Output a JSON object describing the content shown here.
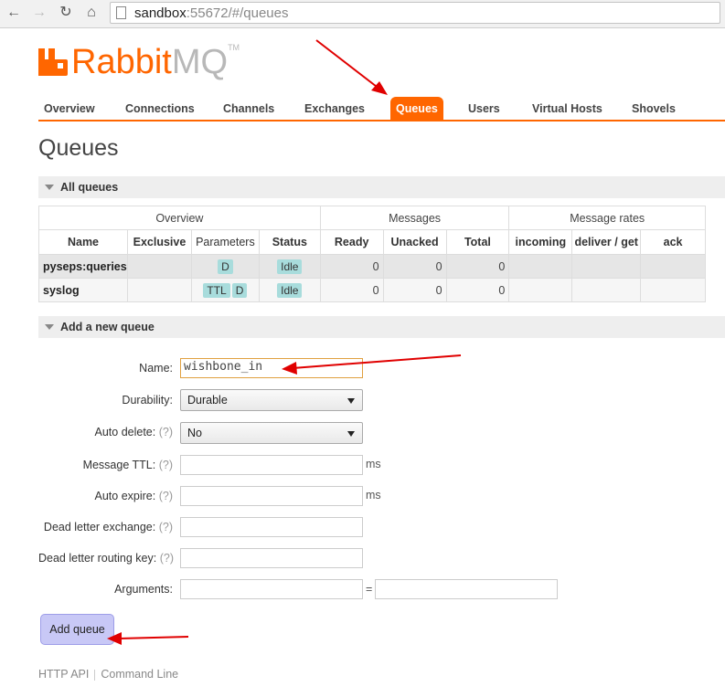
{
  "browser": {
    "url_host": "sandbox",
    "url_rest": ":55672/#/queues",
    "back_icon": "arrow-left",
    "forward_icon": "arrow-right",
    "reload_icon": "reload",
    "home_icon": "home"
  },
  "logo": {
    "rabbit": "Rabbit",
    "mq": "MQ",
    "tm": "TM"
  },
  "nav": {
    "tabs": [
      "Overview",
      "Connections",
      "Channels",
      "Exchanges",
      "Queues",
      "Users",
      "Virtual Hosts",
      "Shovels"
    ],
    "active": "Queues"
  },
  "page_title": "Queues",
  "all_queues": {
    "section_label": "All queues",
    "group_headers": [
      "Overview",
      "Messages",
      "Message rates"
    ],
    "columns": [
      "Name",
      "Exclusive",
      "Parameters",
      "Status",
      "Ready",
      "Unacked",
      "Total",
      "incoming",
      "deliver / get",
      "ack"
    ],
    "rows": [
      {
        "name": "pyseps:queries",
        "exclusive": "",
        "params": [
          "D"
        ],
        "status": "Idle",
        "ready": "0",
        "unacked": "0",
        "total": "0",
        "incoming": "",
        "deliver_get": "",
        "ack": ""
      },
      {
        "name": "syslog",
        "exclusive": "",
        "params": [
          "TTL",
          "D"
        ],
        "status": "Idle",
        "ready": "0",
        "unacked": "0",
        "total": "0",
        "incoming": "",
        "deliver_get": "",
        "ack": ""
      }
    ]
  },
  "add_queue": {
    "section_label": "Add a new queue",
    "name_label": "Name:",
    "name_value": "wishbone_in",
    "durability_label": "Durability:",
    "durability_value": "Durable",
    "auto_delete_label": "Auto delete:",
    "auto_delete_value": "No",
    "message_ttl_label": "Message TTL:",
    "auto_expire_label": "Auto expire:",
    "dlx_label": "Dead letter exchange:",
    "dlrk_label": "Dead letter routing key:",
    "arguments_label": "Arguments:",
    "help": "(?)",
    "unit_ms": "ms",
    "equals": "=",
    "button_label": "Add queue"
  },
  "footer": {
    "http_api": "HTTP API",
    "command_line": "Command Line"
  },
  "colors": {
    "brand": "#ff6600",
    "annotation_arrow": "#e00000",
    "badge": "#a8dcdc",
    "button": "#c8c8f6"
  }
}
